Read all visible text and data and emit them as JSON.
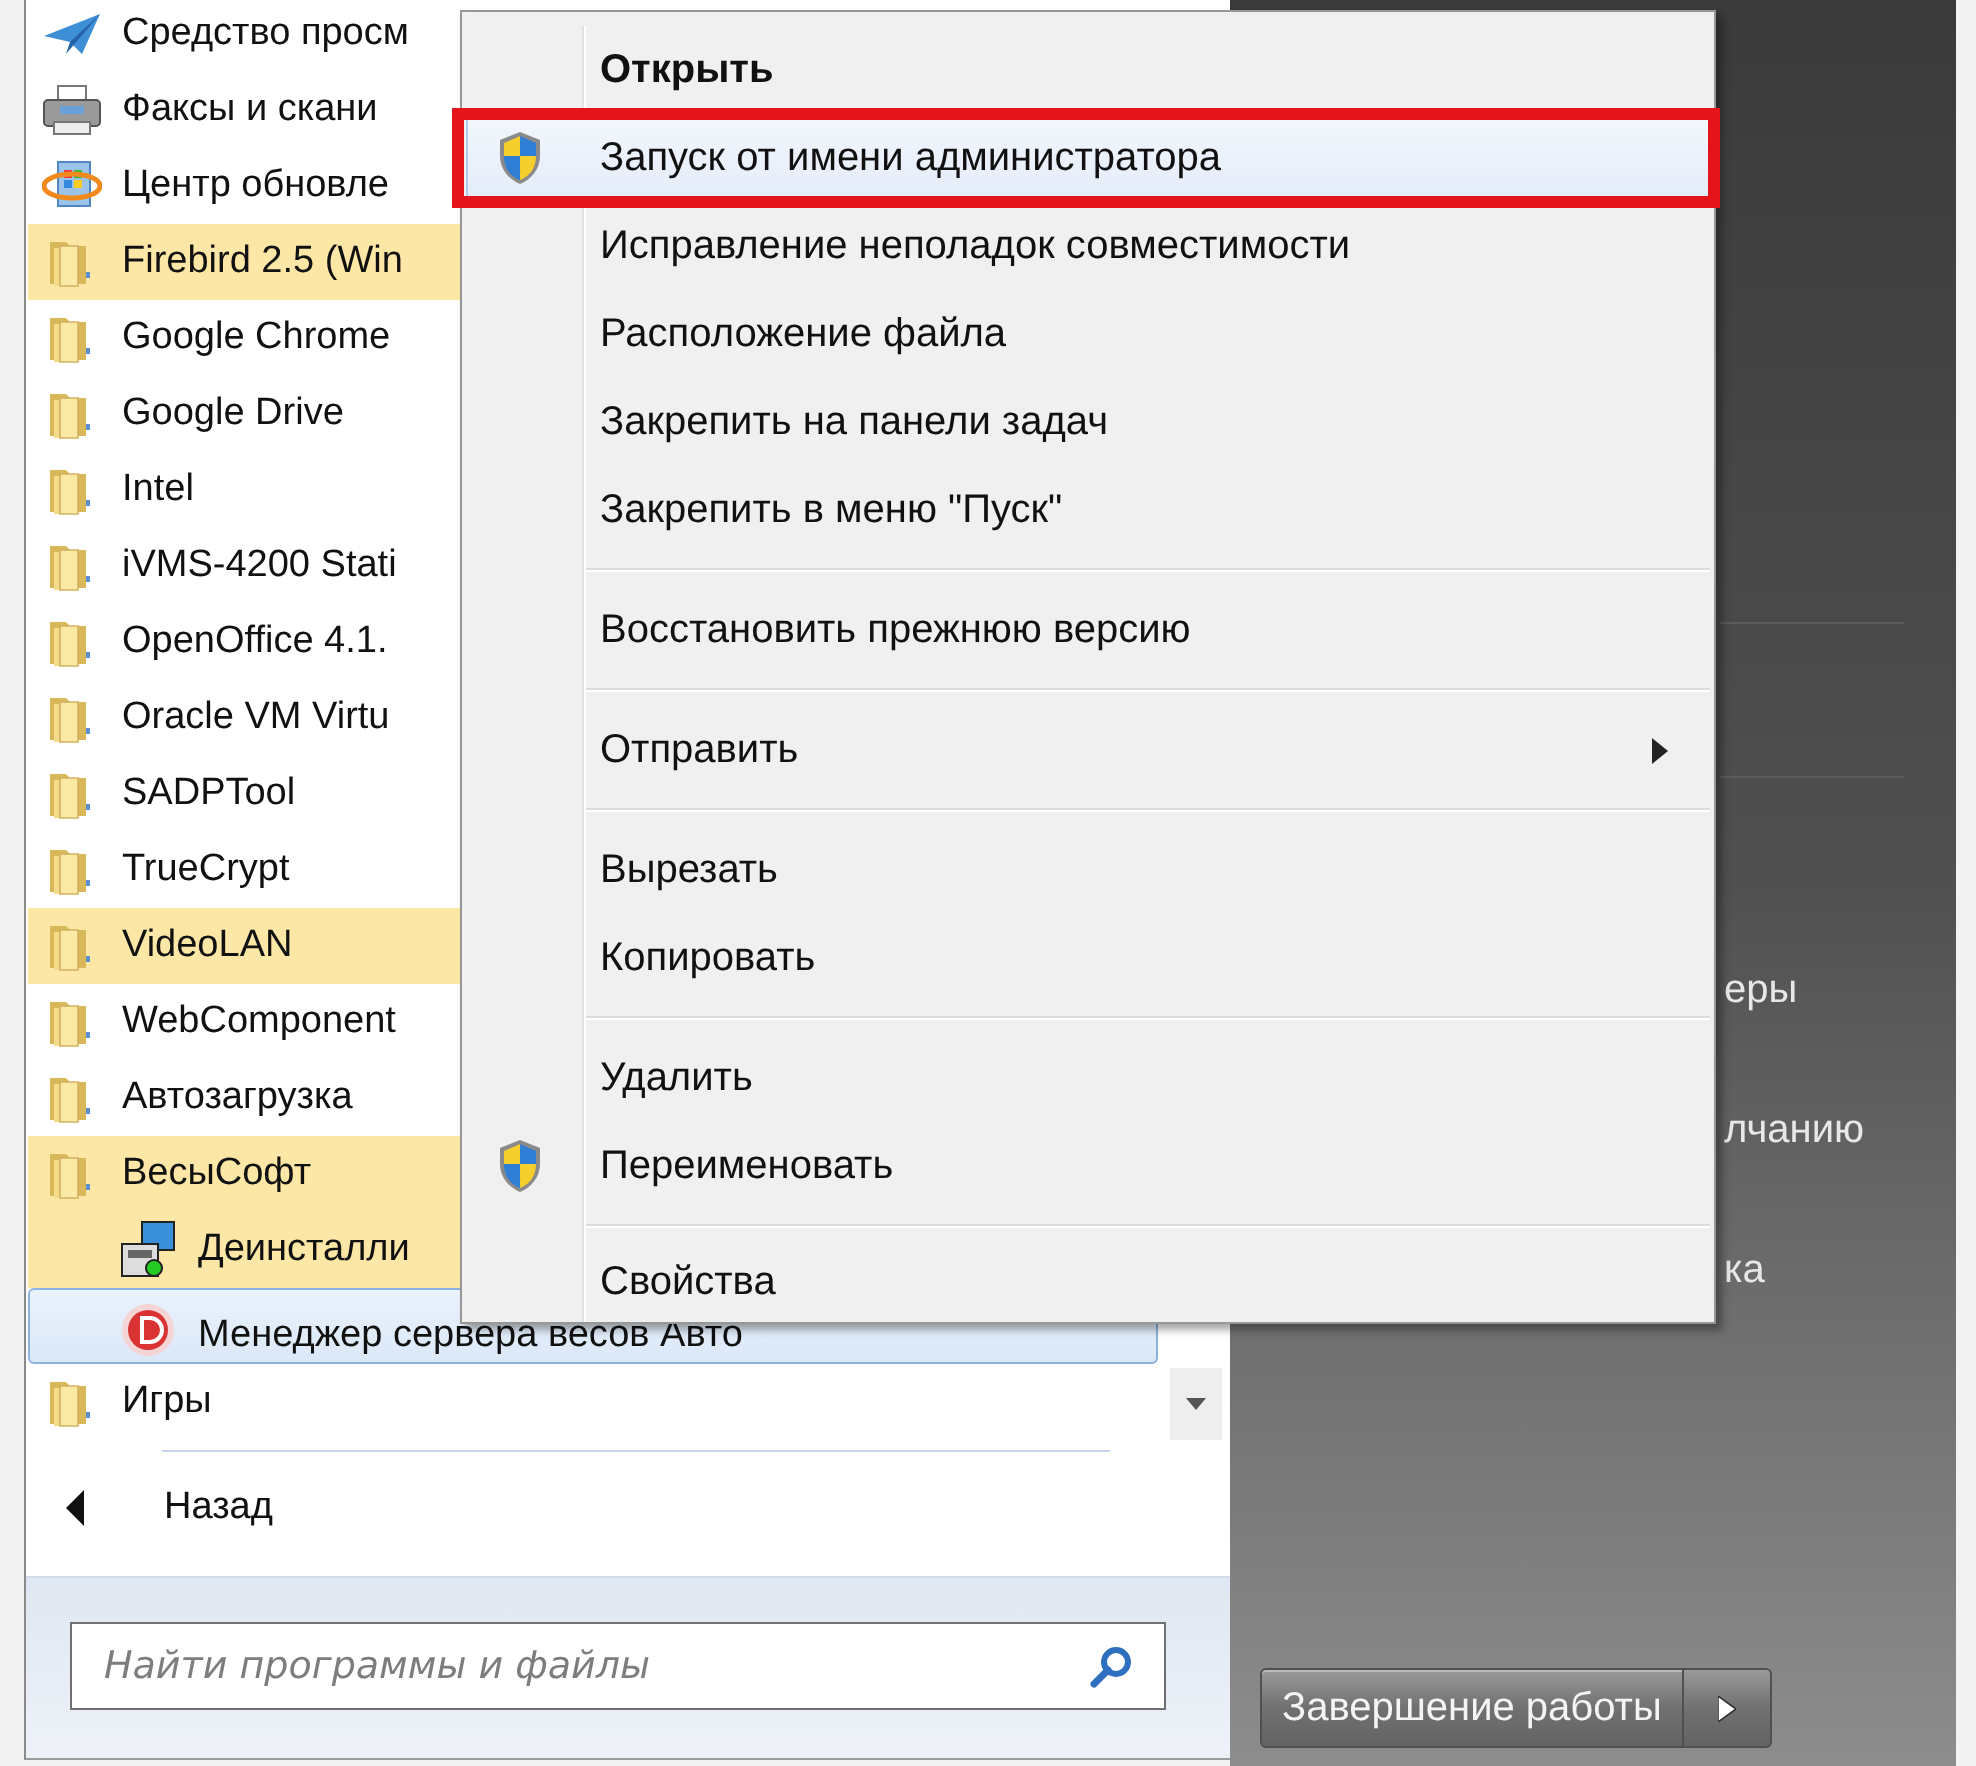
{
  "programs": [
    {
      "label": "Средство просм",
      "kind": "send",
      "new": false,
      "selected": false
    },
    {
      "label": "Факсы и скани",
      "kind": "fax",
      "new": false,
      "selected": false
    },
    {
      "label": "Центр обновле",
      "kind": "update",
      "new": false,
      "selected": false
    },
    {
      "label": "Firebird 2.5 (Win",
      "kind": "folder",
      "new": true,
      "selected": false
    },
    {
      "label": "Google Chrome",
      "kind": "folder",
      "new": false,
      "selected": false
    },
    {
      "label": "Google Drive",
      "kind": "folder",
      "new": false,
      "selected": false
    },
    {
      "label": "Intel",
      "kind": "folder",
      "new": false,
      "selected": false
    },
    {
      "label": "iVMS-4200 Stati",
      "kind": "folder",
      "new": false,
      "selected": false
    },
    {
      "label": "OpenOffice 4.1.",
      "kind": "folder",
      "new": false,
      "selected": false
    },
    {
      "label": "Oracle VM Virtu",
      "kind": "folder",
      "new": false,
      "selected": false
    },
    {
      "label": "SADPTool",
      "kind": "folder",
      "new": false,
      "selected": false
    },
    {
      "label": "TrueCrypt",
      "kind": "folder",
      "new": false,
      "selected": false
    },
    {
      "label": "VideoLAN",
      "kind": "folder",
      "new": true,
      "selected": false
    },
    {
      "label": "WebComponent",
      "kind": "folder",
      "new": false,
      "selected": false
    },
    {
      "label": "Автозагрузка",
      "kind": "folder",
      "new": false,
      "selected": false
    },
    {
      "label": "ВесыСофт",
      "kind": "folder",
      "new": true,
      "selected": false,
      "children": [
        {
          "label": "Деинсталли",
          "kind": "installer",
          "new": true,
          "selected": false
        },
        {
          "label": "Менеджер сервера весов Авто",
          "kind": "server",
          "new": false,
          "selected": true
        }
      ]
    },
    {
      "label": "Игры",
      "kind": "folder",
      "new": false,
      "selected": false
    }
  ],
  "back_button": {
    "label": "Назад"
  },
  "search": {
    "placeholder": "Найти программы и файлы"
  },
  "context_menu": {
    "items": [
      {
        "kind": "item",
        "label": "Открыть",
        "default": true,
        "selected": false
      },
      {
        "kind": "item",
        "label": "Запуск от имени администратора",
        "default": false,
        "shield": true,
        "selected": true,
        "annotated": true
      },
      {
        "kind": "item",
        "label": "Исправление неполадок совместимости",
        "default": false,
        "selected": false
      },
      {
        "kind": "item",
        "label": "Расположение файла",
        "default": false,
        "selected": false
      },
      {
        "kind": "item",
        "label": "Закрепить на панели задач",
        "default": false,
        "selected": false
      },
      {
        "kind": "item",
        "label": "Закрепить в меню \"Пуск\"",
        "default": false,
        "selected": false
      },
      {
        "kind": "separator"
      },
      {
        "kind": "item",
        "label": "Восстановить прежнюю версию",
        "default": false,
        "selected": false
      },
      {
        "kind": "separator"
      },
      {
        "kind": "item",
        "label": "Отправить",
        "default": false,
        "submenu": true,
        "selected": false
      },
      {
        "kind": "separator"
      },
      {
        "kind": "item",
        "label": "Вырезать",
        "default": false,
        "selected": false
      },
      {
        "kind": "item",
        "label": "Копировать",
        "default": false,
        "selected": false
      },
      {
        "kind": "separator"
      },
      {
        "kind": "item",
        "label": "Удалить",
        "default": false,
        "selected": false
      },
      {
        "kind": "item",
        "label": "Переименовать",
        "default": false,
        "shield": true,
        "selected": false
      },
      {
        "kind": "separator"
      },
      {
        "kind": "item",
        "label": "Свойства",
        "default": false,
        "selected": false
      }
    ]
  },
  "right_panel": {
    "items": [
      "еры",
      "лчанию",
      "ка"
    ],
    "shutdown": {
      "label": "Завершение работы"
    }
  }
}
